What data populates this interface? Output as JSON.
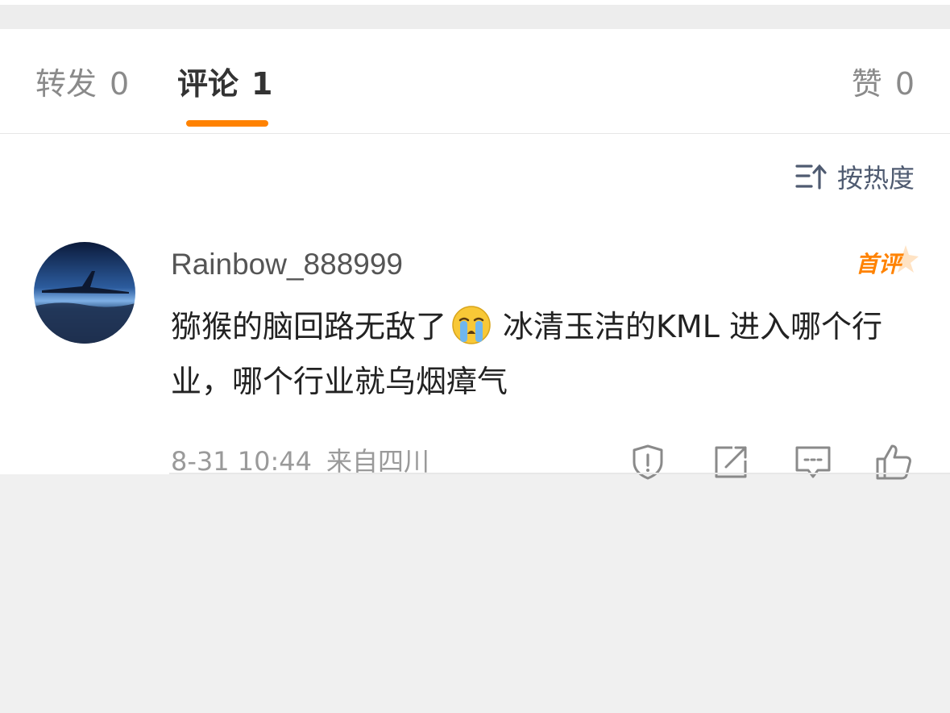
{
  "tabs": {
    "repost": {
      "label": "转发",
      "count": "0"
    },
    "comment": {
      "label": "评论",
      "count": "1"
    },
    "like": {
      "label": "赞",
      "count": "0"
    }
  },
  "sort": {
    "label": "按热度",
    "icon": "sort-icon"
  },
  "comment": {
    "username": "Rainbow_888999",
    "badge": "首评",
    "text_part1": "猕猴的脑回路无敌了",
    "emoji": "crying-emoji",
    "text_part2": "冰清玉洁的KML 进入哪个行业，哪个行业就乌烟瘴气",
    "date": "8-31 10:44",
    "location": "来自四川",
    "actions": [
      "report-icon",
      "share-icon",
      "comment-icon",
      "like-icon"
    ]
  },
  "colors": {
    "accent": "#ff8200",
    "active_tab": "#333333",
    "inactive_tab": "#8a8a8a",
    "sort": "#4f5b71"
  }
}
